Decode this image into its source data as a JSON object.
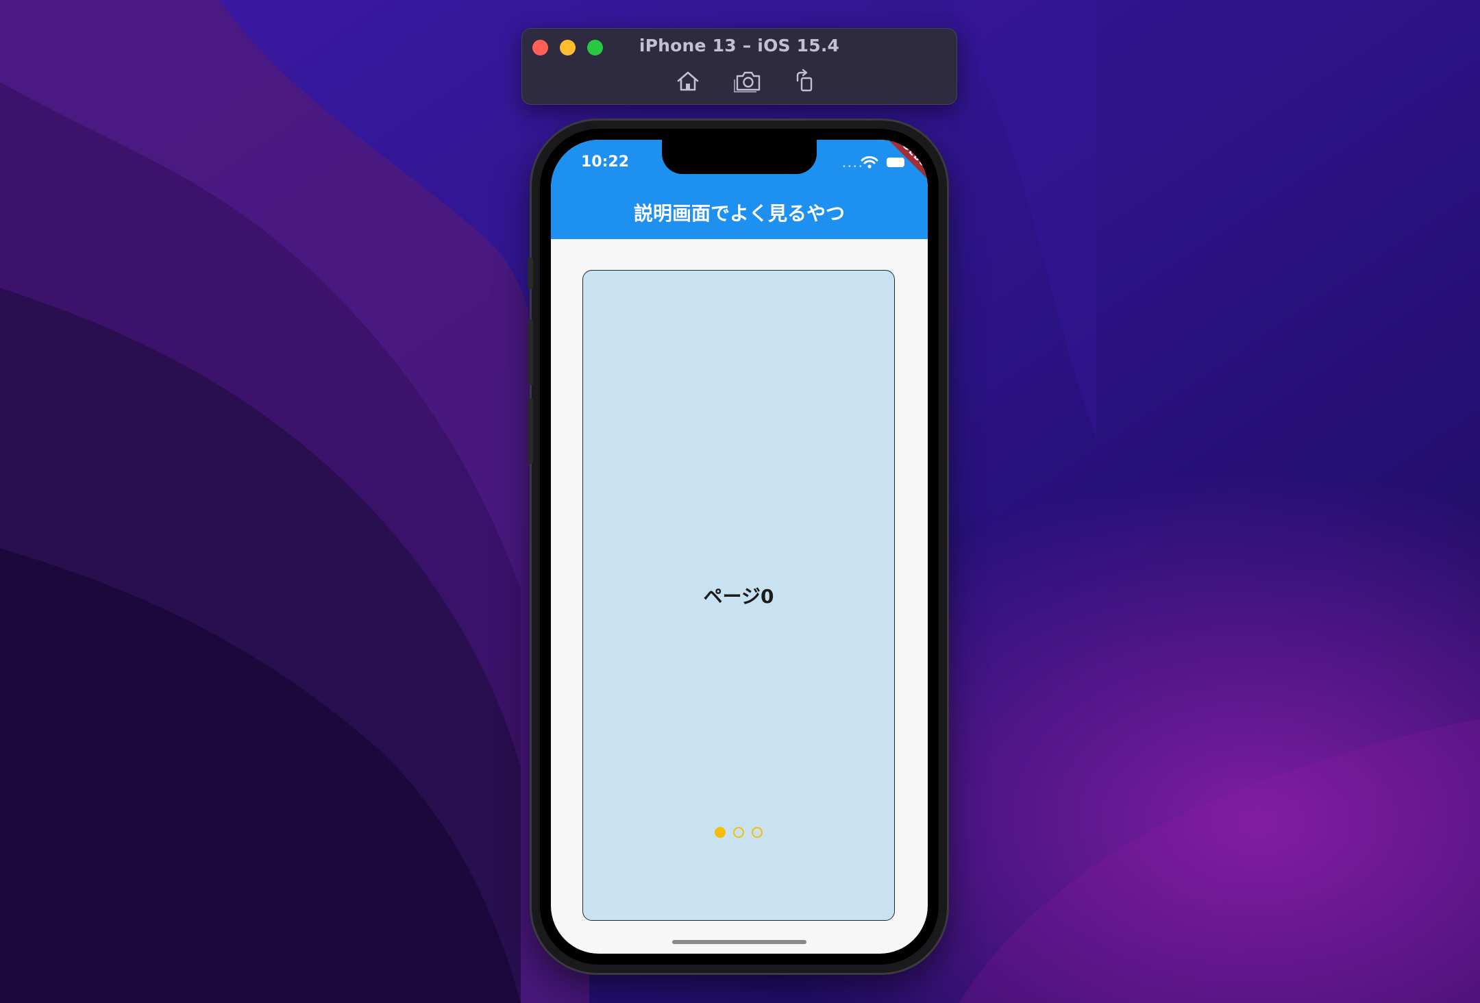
{
  "simulator": {
    "title": "iPhone 13 – iOS 15.4",
    "toolbar": [
      {
        "name": "home-icon",
        "label": "home"
      },
      {
        "name": "screenshot-icon",
        "label": "screenshot"
      },
      {
        "name": "rotate-icon",
        "label": "rotate"
      }
    ]
  },
  "status_bar": {
    "time": "10:22",
    "wifi": "wifi-icon",
    "battery": "battery-icon"
  },
  "debug_banner": "DEBUG",
  "app_bar": {
    "title": "説明画面でよく見るやつ",
    "color": "#1e90f0"
  },
  "page": {
    "label": "ページ0",
    "background": "#c8e2f2"
  },
  "page_indicator": {
    "count": 3,
    "active_index": 0,
    "color": "#f5bd0b"
  }
}
